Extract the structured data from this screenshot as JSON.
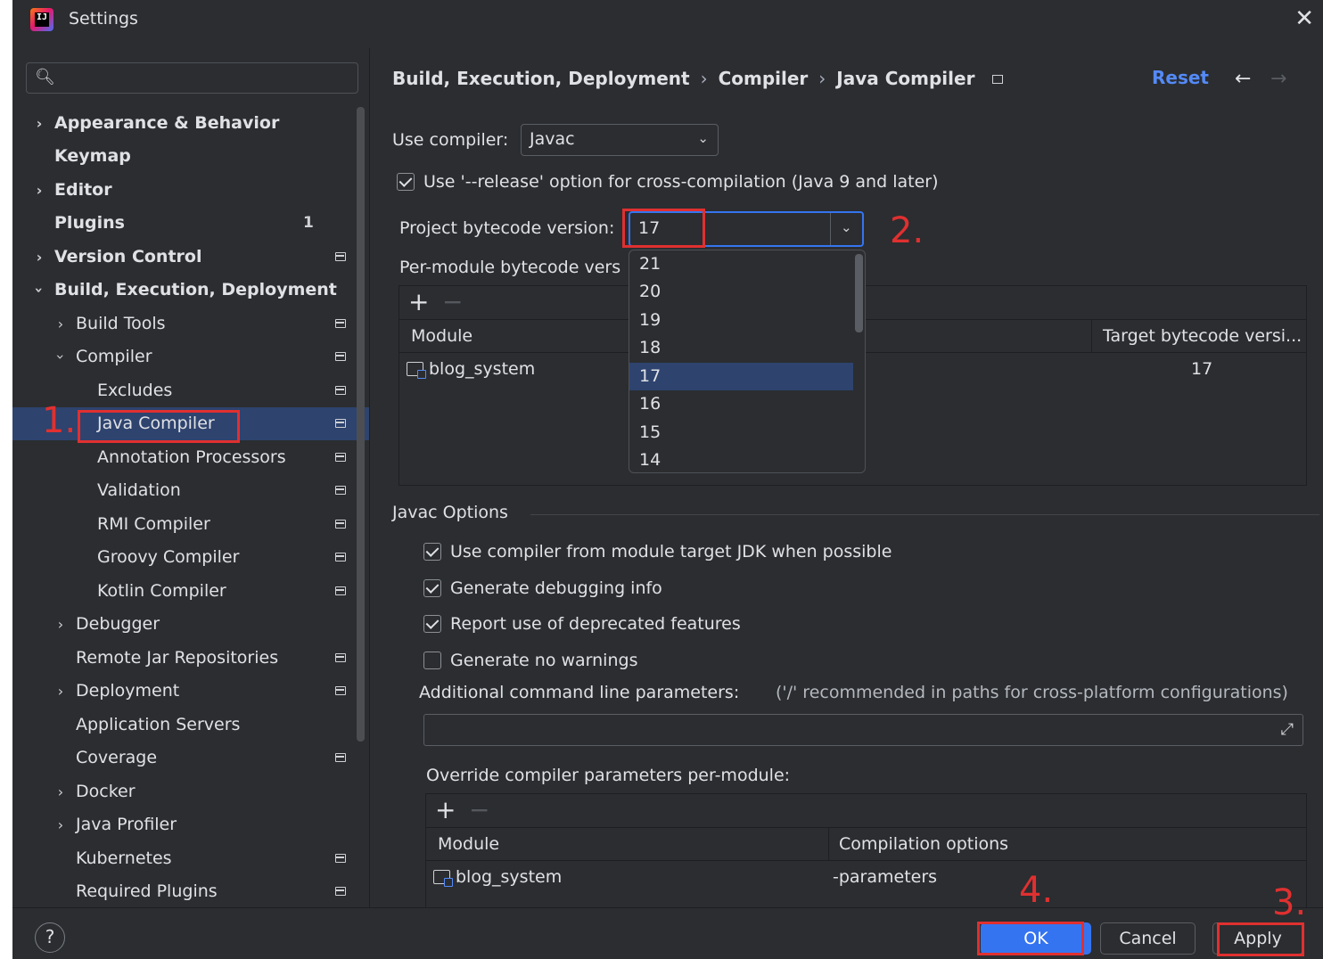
{
  "window": {
    "title": "Settings",
    "app_icon_text": "IJ"
  },
  "search": {
    "placeholder": ""
  },
  "sidebar": {
    "items": [
      {
        "label": "Appearance & Behavior",
        "bold": true
      },
      {
        "label": "Keymap",
        "bold": true
      },
      {
        "label": "Editor",
        "bold": true
      },
      {
        "label": "Plugins",
        "bold": true,
        "badge": "1"
      },
      {
        "label": "Version Control",
        "bold": true
      },
      {
        "label": "Build, Execution, Deployment",
        "bold": true
      },
      {
        "label": "Build Tools"
      },
      {
        "label": "Compiler"
      },
      {
        "label": "Excludes"
      },
      {
        "label": "Java Compiler",
        "selected": true
      },
      {
        "label": "Annotation Processors"
      },
      {
        "label": "Validation"
      },
      {
        "label": "RMI Compiler"
      },
      {
        "label": "Groovy Compiler"
      },
      {
        "label": "Kotlin Compiler"
      },
      {
        "label": "Debugger"
      },
      {
        "label": "Remote Jar Repositories"
      },
      {
        "label": "Deployment"
      },
      {
        "label": "Application Servers"
      },
      {
        "label": "Coverage"
      },
      {
        "label": "Docker"
      },
      {
        "label": "Java Profiler"
      },
      {
        "label": "Kubernetes"
      },
      {
        "label": "Required Plugins"
      }
    ]
  },
  "breadcrumb": {
    "part1": "Build, Execution, Deployment",
    "part2": "Compiler",
    "part3": "Java Compiler",
    "separator": "›"
  },
  "header": {
    "reset_label": "Reset"
  },
  "compiler": {
    "use_compiler_label": "Use compiler:",
    "use_compiler_value": "Javac",
    "release_option_label": "Use '--release' option for cross-compilation (Java 9 and later)",
    "release_option_checked": true,
    "bytecode_label": "Project bytecode version:",
    "bytecode_value": "17",
    "per_module_label": "Per-module bytecode version:",
    "per_module_visible_text": "Per-module bytecode vers"
  },
  "dropdown": {
    "options": [
      "21",
      "20",
      "19",
      "18",
      "17",
      "16",
      "15",
      "14"
    ],
    "selected": "17"
  },
  "module_table": {
    "headers": [
      "Module",
      "Target bytecode versi..."
    ],
    "rows": [
      {
        "module": "blog_system",
        "target": "17"
      }
    ]
  },
  "javac": {
    "section_title": "Javac Options",
    "options": [
      {
        "label": "Use compiler from module target JDK when possible",
        "checked": true
      },
      {
        "label": "Generate debugging info",
        "checked": true
      },
      {
        "label": "Report use of deprecated features",
        "checked": true
      },
      {
        "label": "Generate no warnings",
        "checked": false
      }
    ],
    "additional_label": "Additional command line parameters:",
    "additional_hint": "('/' recommended in paths for cross-platform configurations)",
    "additional_value": "",
    "override_label": "Override compiler parameters per-module:"
  },
  "override_table": {
    "headers": [
      "Module",
      "Compilation options"
    ],
    "rows": [
      {
        "module": "blog_system",
        "options": "-parameters"
      }
    ]
  },
  "footer": {
    "help": "?",
    "ok_label": "OK",
    "cancel_label": "Cancel",
    "apply_label": "Apply"
  },
  "annotations": {
    "a1": "1.",
    "a2": "2.",
    "a3": "3.",
    "a4": "4."
  },
  "colors": {
    "accent": "#3574f0",
    "selection": "#2e436e",
    "link": "#548af7",
    "annotation": "#e03030",
    "background": "#2b2d30"
  }
}
